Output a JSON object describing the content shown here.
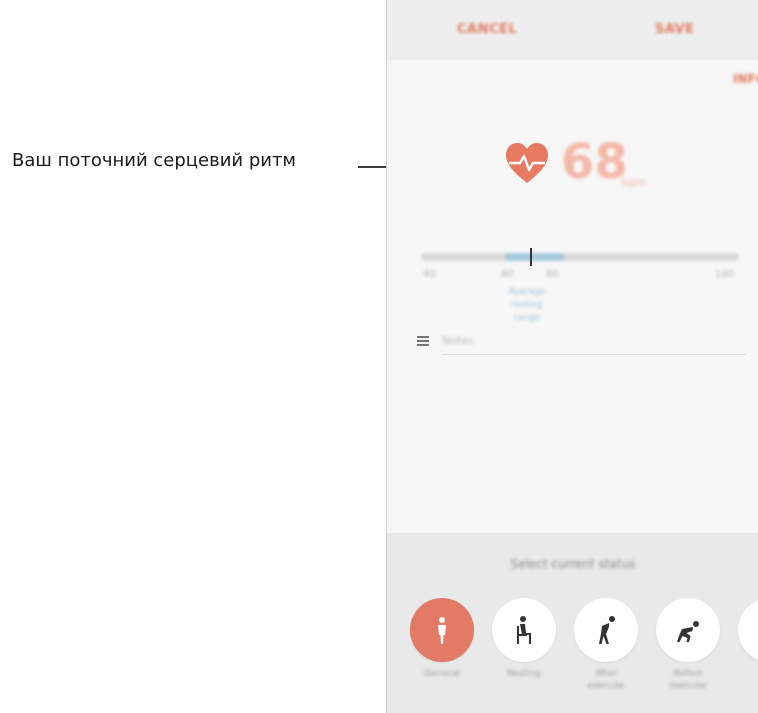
{
  "annotation": {
    "callout": "Ваш поточний серцевий ритм"
  },
  "toolbar": {
    "cancel": "CANCEL",
    "save": "SAVE"
  },
  "info_label": "INFO",
  "reading": {
    "bpm": "68",
    "unit": "bpm"
  },
  "range": {
    "min": "40",
    "range_low": "60",
    "range_high": "80",
    "max": "100",
    "label": "Average resting range",
    "current_position": 0.36
  },
  "notes": {
    "placeholder": "Notes"
  },
  "status": {
    "title": "Select current status",
    "items": [
      {
        "label": "General",
        "icon": "standing-person-icon",
        "selected": true
      },
      {
        "label": "Resting",
        "icon": "sitting-person-icon",
        "selected": false
      },
      {
        "label": "After exercise",
        "icon": "bending-person-icon",
        "selected": false
      },
      {
        "label": "Before exercise",
        "icon": "crouching-person-icon",
        "selected": false
      },
      {
        "label": "",
        "icon": "partial-icon",
        "selected": false
      }
    ]
  },
  "colors": {
    "accent": "#e27a65",
    "heart": "#e87a62",
    "range": "#a5c9dc"
  }
}
